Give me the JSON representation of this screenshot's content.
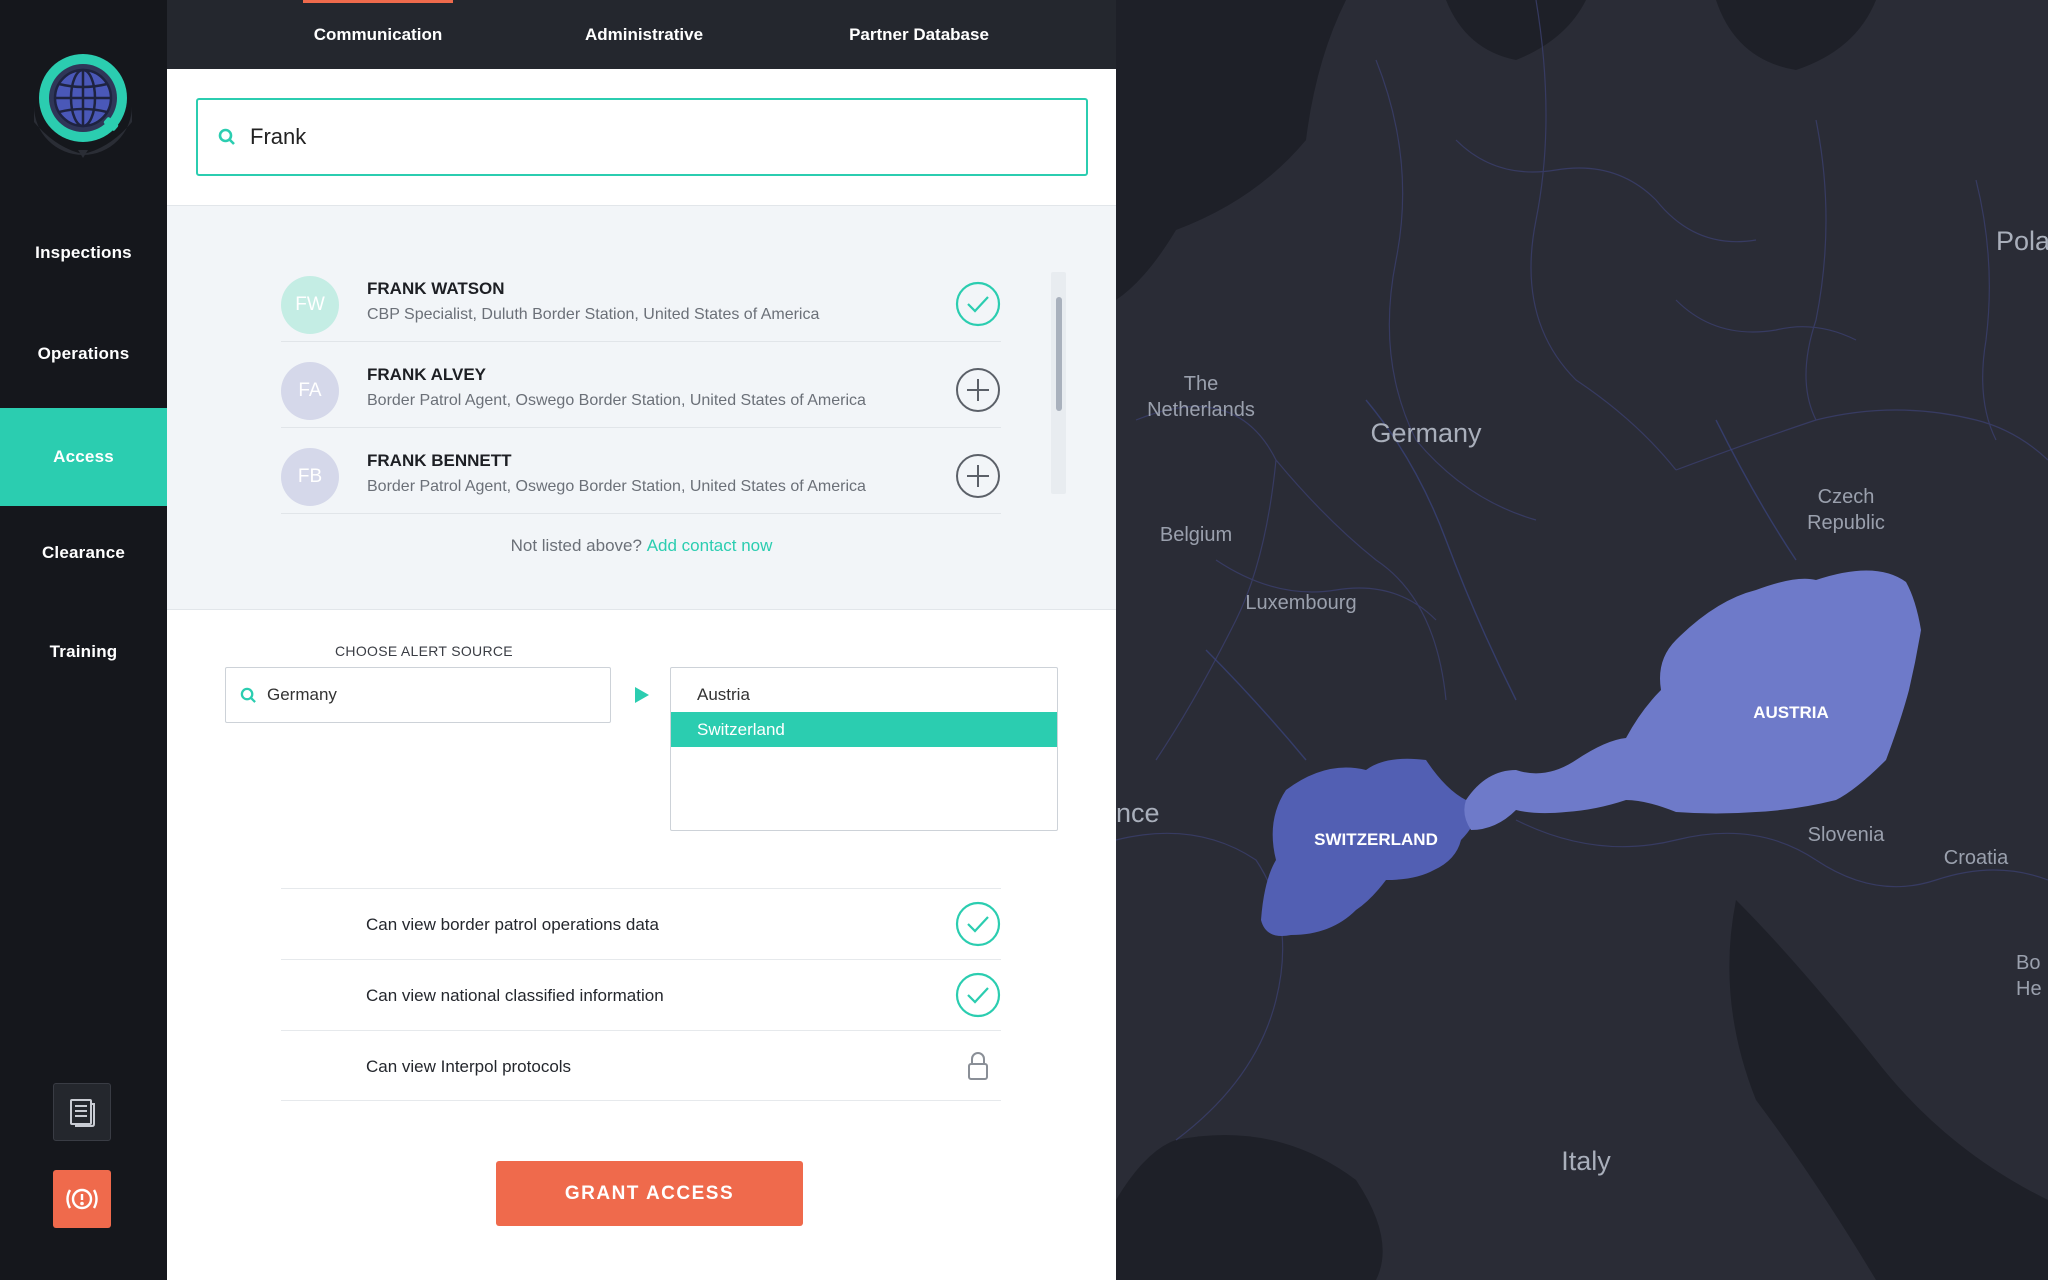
{
  "sidebar": {
    "items": [
      {
        "label": "Inspections"
      },
      {
        "label": "Operations"
      },
      {
        "label": "Access"
      },
      {
        "label": "Clearance"
      },
      {
        "label": "Training"
      }
    ],
    "active": "Access"
  },
  "tabs": [
    {
      "label": "Communication"
    },
    {
      "label": "Administrative"
    },
    {
      "label": "Partner Database"
    }
  ],
  "search": {
    "value": "Frank"
  },
  "results": [
    {
      "initials": "FW",
      "name": "FRANK WATSON",
      "desc": "CBP Specialist, Duluth Border Station, United States of America",
      "status": "added",
      "avatar_color": "#c4ede4"
    },
    {
      "initials": "FA",
      "name": "FRANK ALVEY",
      "desc": "Border Patrol Agent, Oswego Border Station, United States of America",
      "status": "add",
      "avatar_color": "#d5d8ea"
    },
    {
      "initials": "FB",
      "name": "FRANK BENNETT",
      "desc": "Border Patrol Agent, Oswego Border Station, United States of America",
      "status": "add",
      "avatar_color": "#d5d8ea"
    }
  ],
  "not_listed": {
    "text": "Not listed above?",
    "link": "Add contact now"
  },
  "alert_source": {
    "label": "CHOOSE ALERT SOURCE",
    "value": "Germany",
    "destinations": [
      {
        "label": "Austria",
        "selected": false
      },
      {
        "label": "Switzerland",
        "selected": true
      }
    ]
  },
  "permissions": [
    {
      "label": "Can view border patrol operations data",
      "state": "granted"
    },
    {
      "label": "Can view national classified information",
      "state": "granted"
    },
    {
      "label": "Can view Interpol protocols",
      "state": "locked"
    }
  ],
  "grant_button": "GRANT ACCESS",
  "map": {
    "labels": {
      "netherlands": "The\nNetherlands",
      "germany": "Germany",
      "poland": "Pola",
      "belgium": "Belgium",
      "czech": "Czech\nRepublic",
      "luxembourg": "Luxembourg",
      "austria": "AUSTRIA",
      "france": "nce",
      "switzerland": "SWITZERLAND",
      "slovenia": "Slovenia",
      "croatia": "Croatia",
      "bosnia": "Bo\nHe",
      "italy": "Italy"
    }
  },
  "colors": {
    "accent": "#2bcdb0",
    "danger": "#ef6a4c",
    "sidebar": "#15171c",
    "highlight_austria": "#6e7ac9",
    "highlight_switzerland": "#525fb3"
  }
}
